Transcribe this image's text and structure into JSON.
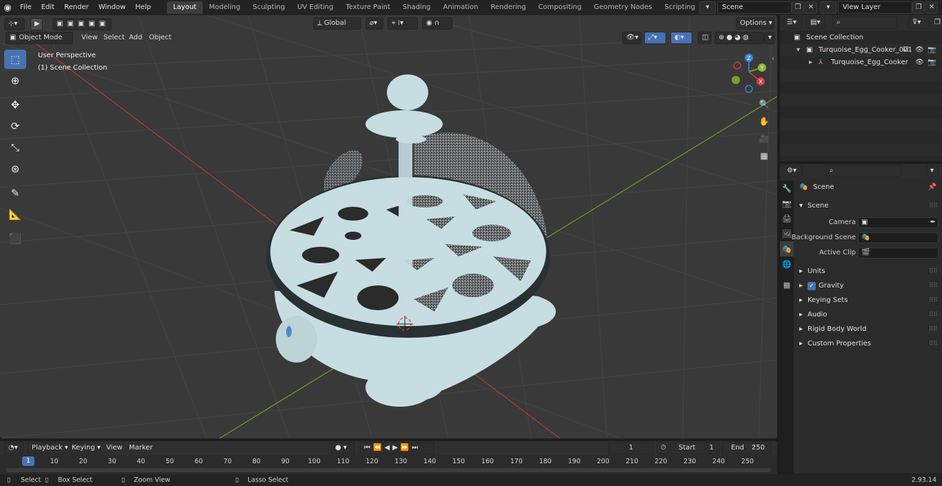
{
  "menu": [
    "File",
    "Edit",
    "Render",
    "Window",
    "Help"
  ],
  "workspaces": [
    "Layout",
    "Modeling",
    "Sculpting",
    "UV Editing",
    "Texture Paint",
    "Shading",
    "Animation",
    "Rendering",
    "Compositing",
    "Geometry Nodes",
    "Scripting"
  ],
  "active_workspace": "Layout",
  "scene_name": "Scene",
  "view_layer": "View Layer",
  "viewport": {
    "mode": "Object Mode",
    "header_menu": [
      "View",
      "Select",
      "Add",
      "Object"
    ],
    "transform_orientation": "Global",
    "options_label": "Options",
    "perspective_label": "User Perspective",
    "collection_label": "(1) Scene Collection",
    "gizmo_axes": [
      "X",
      "Y",
      "Z"
    ]
  },
  "outliner": {
    "root": "Scene Collection",
    "items": [
      {
        "label": "Turquoise_Egg_Cooker_001",
        "depth": 1
      },
      {
        "label": "Turquoise_Egg_Cooker",
        "depth": 2
      }
    ]
  },
  "properties": {
    "context_title": "Scene",
    "section": "Scene",
    "fields": [
      {
        "label": "Camera",
        "value": ""
      },
      {
        "label": "Background Scene",
        "value": ""
      },
      {
        "label": "Active Clip",
        "value": ""
      }
    ],
    "panels": [
      "Units",
      "Gravity",
      "Keying Sets",
      "Audio",
      "Rigid Body World",
      "Custom Properties"
    ],
    "gravity_checked": true
  },
  "timeline": {
    "menus": [
      "Playback",
      "Keying",
      "View",
      "Marker"
    ],
    "current_frame": "1",
    "start_label": "Start",
    "start": "1",
    "end_label": "End",
    "end": "250",
    "ticks": [
      "1",
      "10",
      "20",
      "30",
      "40",
      "50",
      "60",
      "70",
      "80",
      "90",
      "100",
      "110",
      "120",
      "130",
      "140",
      "150",
      "160",
      "170",
      "180",
      "190",
      "200",
      "210",
      "220",
      "230",
      "240",
      "250"
    ]
  },
  "statusbar": {
    "select": "Select",
    "box_select": "Box Select",
    "zoom_view": "Zoom View",
    "lasso_select": "Lasso Select",
    "version": "2.93.14"
  },
  "colors": {
    "accent": "#4772b3",
    "object": "#c6dde2",
    "x_axis": "#b33b45",
    "y_axis": "#7d9c27",
    "z_axis": "#3b78c4"
  }
}
